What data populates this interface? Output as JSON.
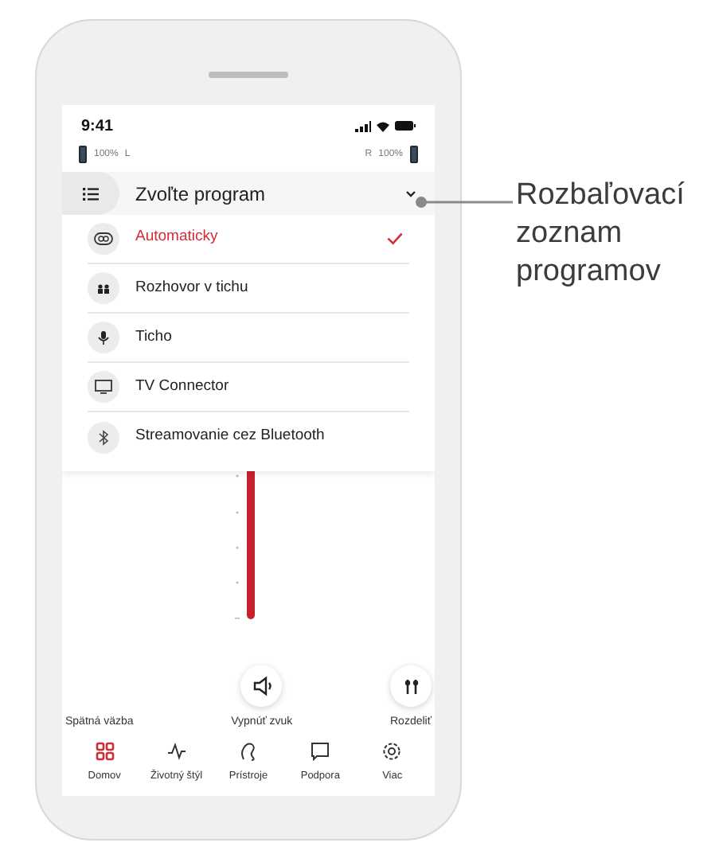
{
  "status_bar": {
    "time": "9:41"
  },
  "hearing_aids": {
    "left": {
      "percent": "100%",
      "side": "L"
    },
    "right": {
      "side": "R",
      "percent": "100%"
    }
  },
  "program_dropdown": {
    "title": "Zvoľte program",
    "expanded": true,
    "items": [
      {
        "label": "Automaticky",
        "kind": "auto",
        "selected": true
      },
      {
        "label": "Rozhovor v tichu",
        "kind": "people",
        "selected": false
      },
      {
        "label": "Ticho",
        "kind": "quiet",
        "selected": false
      },
      {
        "label": "TV Connector",
        "kind": "tv",
        "selected": false
      },
      {
        "label": "Streamovanie cez Bluetooth",
        "kind": "bluetooth",
        "selected": false
      }
    ]
  },
  "actions": [
    {
      "label": "Spätná väzba",
      "kind": "text"
    },
    {
      "label": "Vypnúť zvuk",
      "kind": "mute"
    },
    {
      "label": "Rozdeliť",
      "kind": "split"
    }
  ],
  "nav": [
    {
      "label": "Domov",
      "kind": "home",
      "selected": true
    },
    {
      "label": "Životný štýl",
      "kind": "lifestyle",
      "selected": false
    },
    {
      "label": "Prístroje",
      "kind": "devices",
      "selected": false
    },
    {
      "label": "Podpora",
      "kind": "support",
      "selected": false
    },
    {
      "label": "Viac",
      "kind": "more",
      "selected": false
    }
  ],
  "callout": {
    "text": "Rozbaľovací zoznam programov"
  }
}
